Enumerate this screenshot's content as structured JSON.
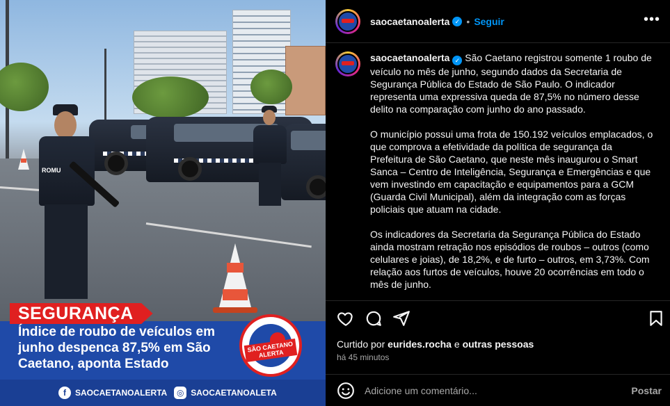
{
  "post_image": {
    "tag": "SEGURANÇA",
    "headline": "Índice de roubo de veículos em junho despenca 87,5% em São Caetano, aponta Estado",
    "badge_label": "SÃO CAETANO ALERTA",
    "officer_patch": "ROMU",
    "socials": [
      {
        "icon": "facebook-icon",
        "glyph": "f",
        "handle": "SAOCAETANOALERTA"
      },
      {
        "icon": "instagram-icon",
        "glyph": "◎",
        "handle": "SAOCAETANOALETA"
      }
    ]
  },
  "header": {
    "username": "saocaetanoalerta",
    "verified_glyph": "✓",
    "separator": "•",
    "follow_label": "Seguir",
    "more_glyph": "•••"
  },
  "caption": {
    "username": "saocaetanoalerta",
    "paragraphs": [
      "São Caetano registrou somente 1 roubo de veículo no mês de junho, segundo dados da Secretaria de Segurança Pública do Estado de São Paulo. O indicador representa uma expressiva queda de 87,5% no número desse delito na comparação com junho do ano passado.",
      "O município possui uma frota de 150.192 veículos emplacados, o que comprova a efetividade da política de segurança da Prefeitura de São Caetano, que neste mês inaugurou o Smart Sanca – Centro de Inteligência, Segurança e Emergências e que vem investindo em capacitação e equipamentos para a GCM (Guarda Civil Municipal), além da integração com as forças policiais que atuam na cidade.",
      "Os indicadores da Secretaria da Segurança Pública do Estado ainda mostram retração nos episódios de roubos – outros (como celulares e joias), de 18,2%, e de furto – outros, em 3,73%. Com relação aos furtos de veículos, houve 20 ocorrências em todo o mês de junho."
    ]
  },
  "actions": {
    "like_icon": "heart-icon",
    "comment_icon": "comment-icon",
    "share_icon": "share-icon",
    "save_icon": "bookmark-icon"
  },
  "likes": {
    "prefix": "Curtido por",
    "user": "eurides.rocha",
    "conjunction": "e",
    "others": "outras pessoas"
  },
  "timestamp": "há 45 minutos",
  "comment": {
    "placeholder": "Adicione um comentário...",
    "post_label": "Postar"
  },
  "colors": {
    "background": "#000000",
    "accent": "#0095f6",
    "brand_blue": "#1f4aa8",
    "brand_red": "#e02020",
    "muted": "#a8a8a8"
  }
}
